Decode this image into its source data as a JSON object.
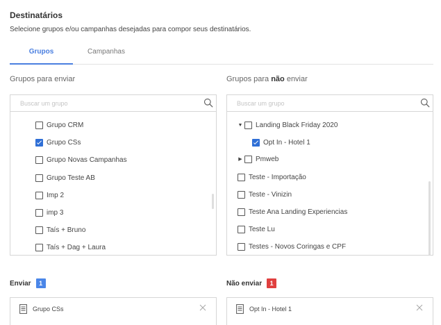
{
  "header": {
    "title": "Destinatários",
    "subtitle": "Selecione grupos e/ou campanhas desejadas para compor seus destinatários."
  },
  "tabs": [
    {
      "label": "Grupos",
      "active": true
    },
    {
      "label": "Campanhas",
      "active": false
    }
  ],
  "send_groups": {
    "label": "Grupos para enviar",
    "search_placeholder": "Buscar um grupo",
    "search_icon": "search-icon",
    "items": [
      {
        "label": "Grupo CRM",
        "checked": false
      },
      {
        "label": "Grupo CSs",
        "checked": true
      },
      {
        "label": "Grupo Novas Campanhas",
        "checked": false
      },
      {
        "label": "Grupo Teste AB",
        "checked": false
      },
      {
        "label": "Imp 2",
        "checked": false
      },
      {
        "label": "imp 3",
        "checked": false
      },
      {
        "label": "Taís + Bruno",
        "checked": false
      },
      {
        "label": "Taís + Dag + Laura",
        "checked": false
      }
    ]
  },
  "exclude_groups": {
    "label_prefix": "Grupos para ",
    "label_bold": "não",
    "label_suffix": " enviar",
    "search_placeholder": "Buscar um grupo",
    "search_icon": "search-icon",
    "items": [
      {
        "label": "Landing Black Friday 2020",
        "checked": false,
        "caret": "expanded",
        "level": 0
      },
      {
        "label": "Opt In - Hotel 1",
        "checked": true,
        "level": 1
      },
      {
        "label": "Pmweb",
        "checked": false,
        "caret": "collapsed",
        "level": 0
      },
      {
        "label": "Teste - Importação",
        "checked": false,
        "level": 0
      },
      {
        "label": "Teste - Vinizin",
        "checked": false,
        "level": 0
      },
      {
        "label": "Teste Ana Landing Experiencias",
        "checked": false,
        "level": 0
      },
      {
        "label": "Teste Lu",
        "checked": false,
        "level": 0
      },
      {
        "label": "Testes - Novos Coringas e CPF",
        "checked": false,
        "level": 0
      }
    ]
  },
  "send_selected": {
    "label": "Enviar",
    "count": "1",
    "badge_color": "#4a86e8",
    "items": [
      {
        "label": "Grupo CSs",
        "icon": "document-list-icon"
      }
    ]
  },
  "exclude_selected": {
    "label": "Não enviar",
    "count": "1",
    "badge_color": "#e0403f",
    "items": [
      {
        "label": "Opt In - Hotel 1",
        "icon": "document-list-icon"
      }
    ]
  },
  "colors": {
    "accent": "#4a7fe0",
    "checkbox_checked": "#2f6fd6",
    "badge_send": "#4a86e8",
    "badge_exclude": "#e0403f"
  }
}
